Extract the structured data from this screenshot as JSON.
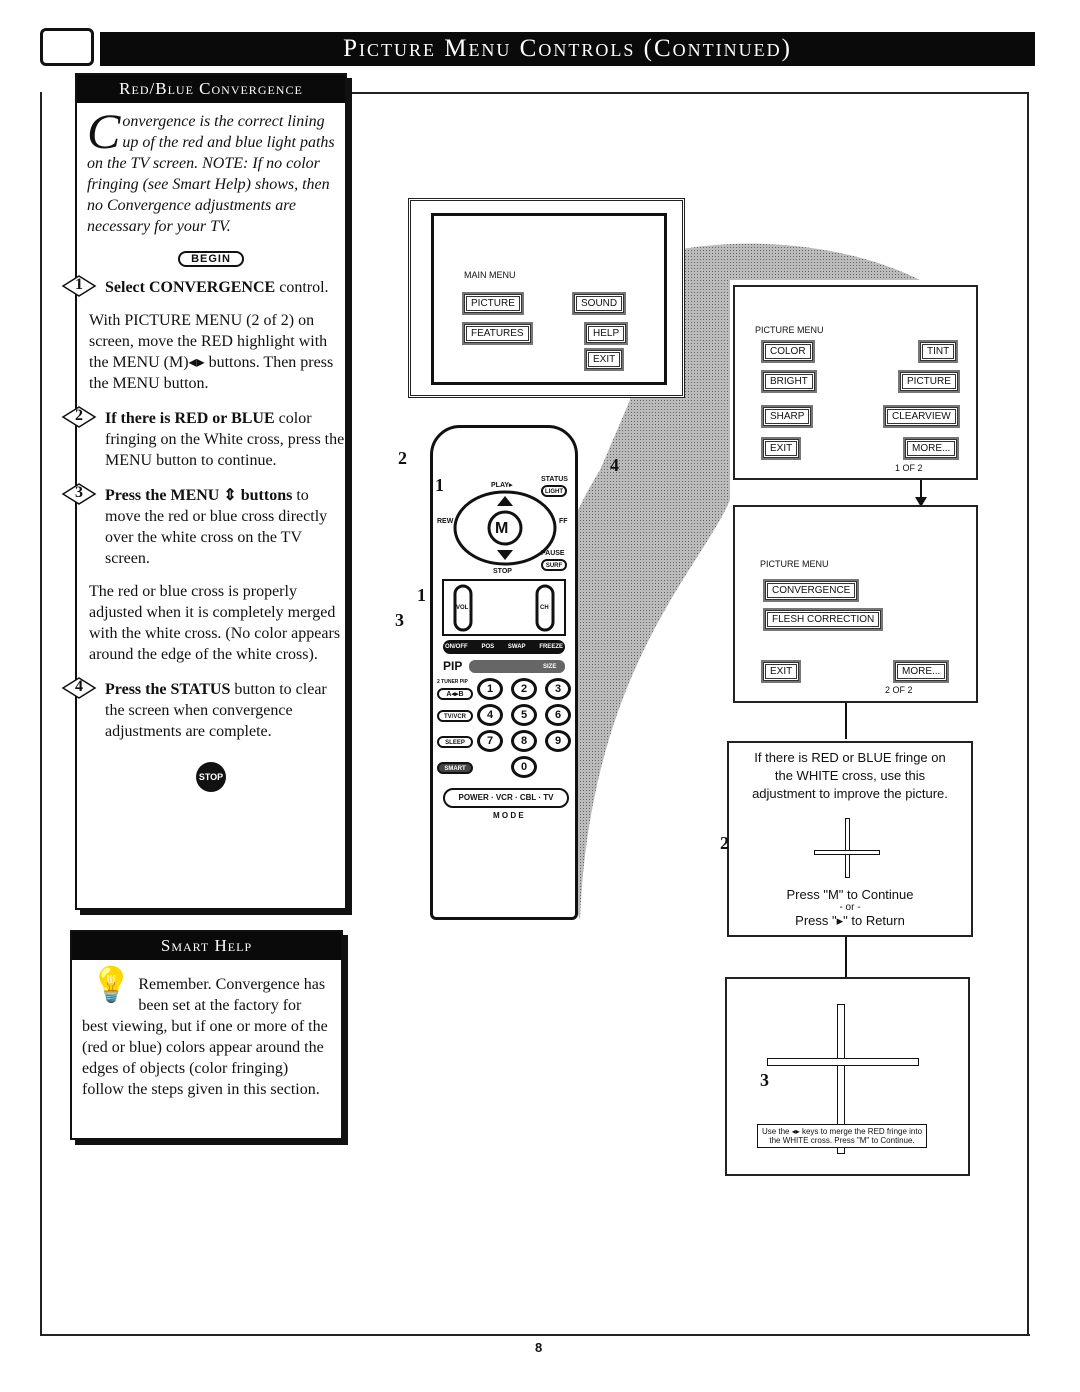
{
  "header": {
    "title": "Picture Menu Controls (Continued)",
    "icon": "tv-screen-icon"
  },
  "left_panel": {
    "title": "Red/Blue Convergence",
    "intro_dropcap": "C",
    "intro": "onvergence is the correct lining up of the red and blue light paths on the TV screen. NOTE: If no color fringing (see Smart Help) shows, then no Convergence adjustments are necessary for your TV.",
    "begin": "BEGIN",
    "steps": [
      {
        "num": "1",
        "bold": "Select CONVERGENCE",
        "text": " control."
      },
      {
        "num": "2",
        "bold": "If there is RED or BLUE",
        "text": " color fringing on the White cross, press the MENU button to continue."
      },
      {
        "num": "3",
        "bold": "Press the MENU ⇕ buttons",
        "text": " to move the red or blue cross directly over the white cross on the TV screen."
      },
      {
        "num": "4",
        "bold": "Press the STATUS",
        "text": " button to clear the screen when convergence adjustments are complete."
      }
    ],
    "para1": "With PICTURE MENU (2 of 2) on screen, move the RED highlight with the MENU (M)◂▸ buttons. Then press the MENU button.",
    "para3": "The red or blue cross is properly adjusted when it is completely merged with the white cross. (No color appears around the edge of the white cross).",
    "stop": "STOP"
  },
  "smart_help": {
    "title": "Smart Help",
    "icon": "lightbulb-icon",
    "text": "Remember. Convergence has been set at the factory for best viewing, but if one or more of the (red or blue) colors appear around the edges of objects (color fringing) follow the steps given in this section."
  },
  "main_menu": {
    "title": "MAIN MENU",
    "items": [
      "PICTURE",
      "SOUND",
      "FEATURES",
      "HELP",
      "EXIT"
    ]
  },
  "picture_menu_1": {
    "title": "PICTURE MENU",
    "items": [
      "COLOR",
      "TINT",
      "BRIGHT",
      "PICTURE",
      "SHARP",
      "CLEARVIEW",
      "EXIT",
      "MORE..."
    ],
    "page": "1 OF 2"
  },
  "picture_menu_2": {
    "title": "PICTURE MENU",
    "items": [
      "CONVERGENCE",
      "FLESH CORRECTION",
      "EXIT",
      "MORE..."
    ],
    "page": "2 OF 2"
  },
  "remote": {
    "labels": [
      "PLAY▸",
      "STATUS",
      "LIGHT",
      "REW",
      "FF",
      "M",
      "PAUSE",
      "SURF",
      "STOP",
      "VOL",
      "CH",
      "ON/OFF",
      "POS",
      "SWAP",
      "FREEZE",
      "PIP",
      "SIZE",
      "2 TUNER PIP",
      "TV/VCR",
      "SLEEP",
      "SMART",
      "POWER",
      "VCR",
      "CBL",
      "TV",
      "M O D E"
    ],
    "digits": [
      "1",
      "2",
      "3",
      "4",
      "5",
      "6",
      "7",
      "8",
      "9",
      "0"
    ],
    "callouts": [
      "2",
      "1",
      "4",
      "1",
      "3"
    ]
  },
  "info_box": {
    "text": "If there is RED or BLUE fringe on the WHITE cross, use this adjustment to improve the picture.",
    "continue": "Press \"M\" to Continue",
    "or": "- or -",
    "return": "Press \"▸\" to Return",
    "callout": "2"
  },
  "final_box": {
    "text": "Use the ◂▸ keys to merge the RED fringe into the WHITE cross. Press \"M\" to Continue.",
    "callout": "3"
  },
  "page_number": "8"
}
